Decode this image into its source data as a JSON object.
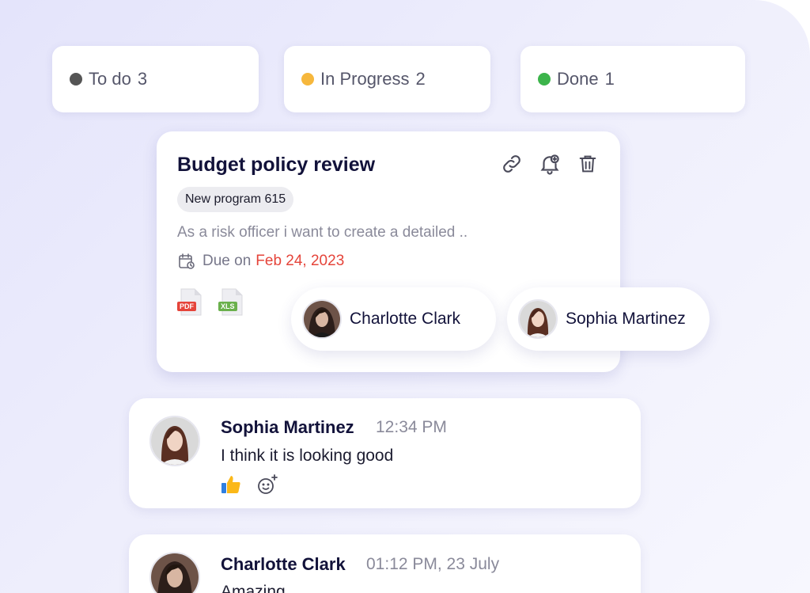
{
  "statuses": [
    {
      "label": "To do",
      "count": "3",
      "color": "#555555"
    },
    {
      "label": "In Progress",
      "count": "2",
      "color": "#f6b73c"
    },
    {
      "label": "Done",
      "count": "1",
      "color": "#3cb44b"
    }
  ],
  "task": {
    "title": "Budget policy review",
    "tag": "New program 615",
    "description": "As a risk officer i want to create a detailed ..",
    "due_prefix": "Due on",
    "due_date": "Feb 24, 2023",
    "files": [
      {
        "type": "PDF",
        "color": "#e5443a"
      },
      {
        "type": "XLS",
        "color": "#6ab04c"
      }
    ],
    "actions": {
      "link_icon": "link-icon",
      "reminder_icon": "bell-plus-icon",
      "delete_icon": "trash-icon"
    }
  },
  "assignees": [
    {
      "name": "Charlotte Clark"
    },
    {
      "name": "Sophia Martinez"
    }
  ],
  "comments": [
    {
      "author": "Sophia Martinez",
      "time": "12:34 PM",
      "text": "I think it is looking good"
    },
    {
      "author": "Charlotte Clark",
      "time": "01:12 PM, 23 July",
      "text": "Amazing"
    }
  ],
  "colors": {
    "accent_red": "#e5443a",
    "title_dark": "#12123a"
  }
}
